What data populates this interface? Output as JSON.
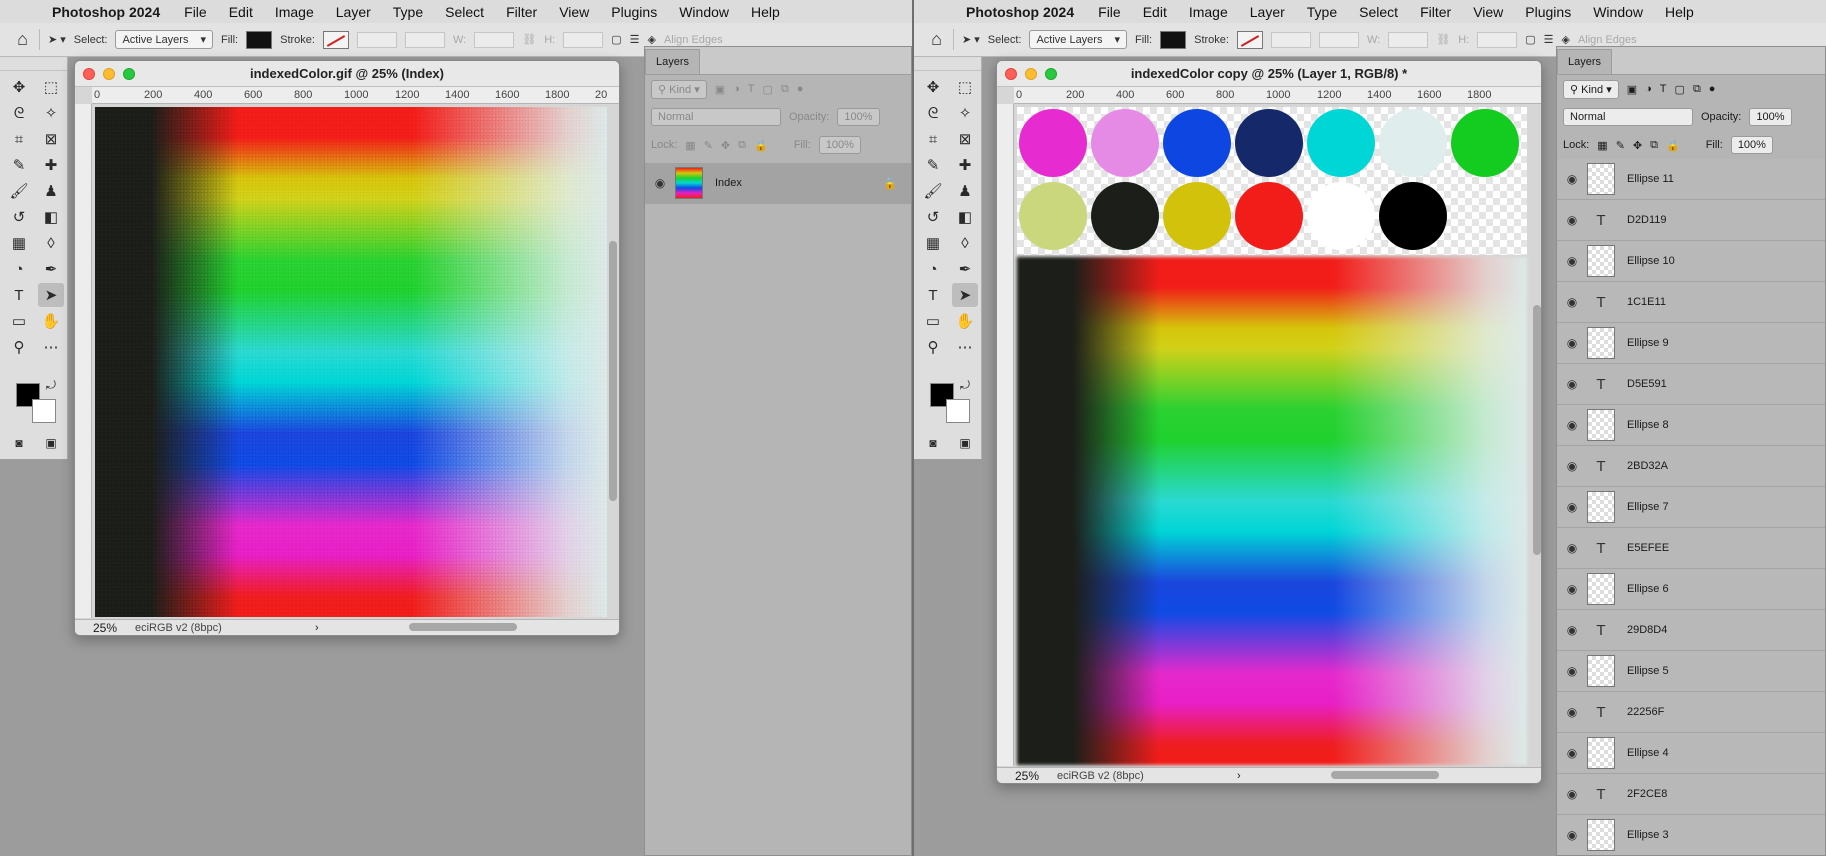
{
  "app": "Photoshop 2024",
  "menu": [
    "File",
    "Edit",
    "Image",
    "Layer",
    "Type",
    "Select",
    "Filter",
    "View",
    "Plugins",
    "Window",
    "Help"
  ],
  "options": {
    "select_label": "Select:",
    "select_value": "Active Layers",
    "fill_label": "Fill:",
    "stroke_label": "Stroke:",
    "w_label": "W:",
    "h_label": "H:",
    "align_edges": "Align Edges"
  },
  "left_doc": {
    "title": "indexedColor.gif @ 25% (Index)",
    "zoom": "25%",
    "profile": "eciRGB v2 (8bpc)",
    "ruler_ticks": [
      "0",
      "200",
      "400",
      "600",
      "800",
      "1000",
      "1200",
      "1400",
      "1600",
      "1800",
      "20"
    ]
  },
  "right_doc": {
    "title": "indexedColor copy @ 25% (Layer 1, RGB/8) *",
    "zoom": "25%",
    "profile": "eciRGB v2 (8bpc)",
    "ruler_ticks": [
      "0",
      "200",
      "400",
      "600",
      "800",
      "1000",
      "1200",
      "1400",
      "1600",
      "1800"
    ]
  },
  "chips": [
    {
      "color": "#e62bd0"
    },
    {
      "color": "#e58be6"
    },
    {
      "color": "#0d46e0"
    },
    {
      "color": "#14286a"
    },
    {
      "color": "#00d6d6"
    },
    {
      "color": "#dfeeed"
    },
    {
      "color": "#13cc1f"
    },
    {
      "color": "#cbd77d"
    },
    {
      "color": "#1c1e19"
    },
    {
      "color": "#d2c20c"
    },
    {
      "color": "#f21d19"
    },
    {
      "color": "#ffffff"
    },
    {
      "color": "#000000"
    }
  ],
  "left_layers": {
    "tab": "Layers",
    "kind": "Kind",
    "blend": "Normal",
    "opacity_label": "Opacity:",
    "opacity": "100%",
    "lock_label": "Lock:",
    "fill_label": "Fill:",
    "fill": "100%",
    "items": [
      {
        "name": "Index"
      }
    ]
  },
  "right_layers": {
    "tab": "Layers",
    "kind": "Kind",
    "blend": "Normal",
    "opacity_label": "Opacity:",
    "opacity": "100%",
    "lock_label": "Lock:",
    "fill_label": "Fill:",
    "fill": "100%",
    "items": [
      {
        "kind": "shape",
        "name": "Ellipse 11"
      },
      {
        "kind": "text",
        "name": "D2D119"
      },
      {
        "kind": "shape",
        "name": "Ellipse 10"
      },
      {
        "kind": "text",
        "name": "1C1E11"
      },
      {
        "kind": "shape",
        "name": "Ellipse 9"
      },
      {
        "kind": "text",
        "name": "D5E591"
      },
      {
        "kind": "shape",
        "name": "Ellipse 8"
      },
      {
        "kind": "text",
        "name": "2BD32A"
      },
      {
        "kind": "shape",
        "name": "Ellipse 7"
      },
      {
        "kind": "text",
        "name": "E5EFEE"
      },
      {
        "kind": "shape",
        "name": "Ellipse 6"
      },
      {
        "kind": "text",
        "name": "29D8D4"
      },
      {
        "kind": "shape",
        "name": "Ellipse 5"
      },
      {
        "kind": "text",
        "name": "22256F"
      },
      {
        "kind": "shape",
        "name": "Ellipse 4"
      },
      {
        "kind": "text",
        "name": "2F2CE8"
      },
      {
        "kind": "shape",
        "name": "Ellipse 3"
      }
    ]
  }
}
